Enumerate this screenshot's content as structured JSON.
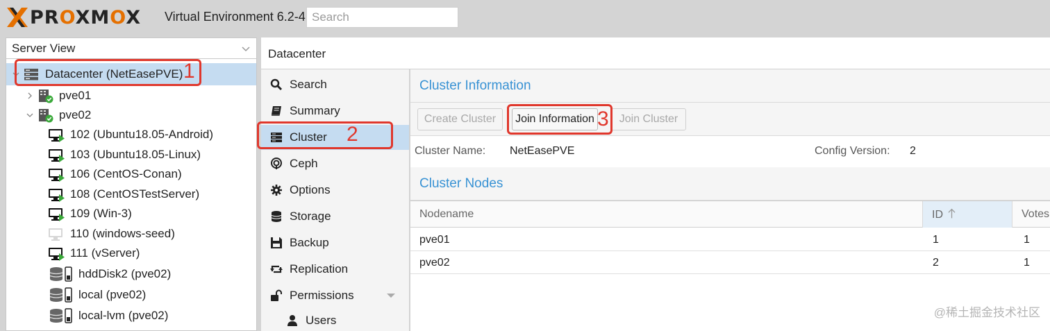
{
  "header": {
    "logo_text_1": "PR",
    "logo_text_o1": "O",
    "logo_text_2": "XM",
    "logo_text_o2": "O",
    "logo_text_3": "X",
    "version": "Virtual Environment 6.2-4",
    "search_placeholder": "Search"
  },
  "tree": {
    "view_label": "Server View",
    "datacenter": "Datacenter (NetEasePVE)",
    "nodes": [
      "pve01",
      "pve02"
    ],
    "vms": [
      "102 (Ubuntu18.05-Android)",
      "103 (Ubuntu18.05-Linux)",
      "106 (CentOS-Conan)",
      "108 (CentOSTestServer)",
      "109 (Win-3)",
      "110 (windows-seed)",
      "111 (vServer)"
    ],
    "storages": [
      "hddDisk2 (pve02)",
      "local (pve02)",
      "local-lvm (pve02)"
    ]
  },
  "center": {
    "title": "Datacenter"
  },
  "nav": {
    "items": [
      "Search",
      "Summary",
      "Cluster",
      "Ceph",
      "Options",
      "Storage",
      "Backup",
      "Replication",
      "Permissions",
      "Users"
    ]
  },
  "cluster": {
    "info_title": "Cluster Information",
    "buttons": {
      "create": "Create Cluster",
      "join_info": "Join Information",
      "join": "Join Cluster"
    },
    "name_label": "Cluster Name:",
    "name_value": "NetEasePVE",
    "version_label": "Config Version:",
    "version_value": "2",
    "nodes_title": "Cluster Nodes",
    "columns": [
      "Nodename",
      "ID",
      "Votes"
    ],
    "rows": [
      {
        "nodename": "pve01",
        "id": "1",
        "votes": "1"
      },
      {
        "nodename": "pve02",
        "id": "2",
        "votes": "1"
      }
    ]
  },
  "annotations": [
    "1",
    "2",
    "3"
  ],
  "watermark": "@稀土掘金技术社区",
  "colors": {
    "accent_orange": "#e57000",
    "annotation_red": "#e0372c",
    "selection_blue": "#c5dcf1",
    "title_blue": "#3892d4",
    "running_green": "#3aa93a"
  }
}
